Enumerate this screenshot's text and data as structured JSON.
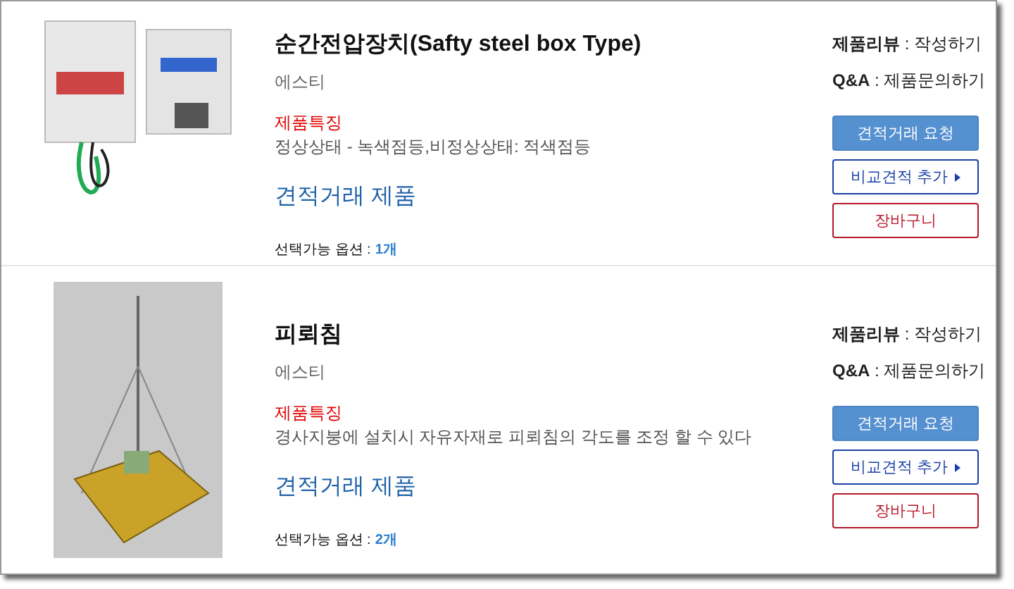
{
  "products": [
    {
      "title": "순간전압장치(Safty steel box Type)",
      "maker": "에스티",
      "feature_label": "제품특징",
      "feature": "정상상태 - 녹색점등,비정상상태: 적색점등",
      "deal_type": "견적거래 제품",
      "options_label": "선택가능 옵션 :",
      "options_count": "1개",
      "review": "**제품리뷰** : 작성하기",
      "qna": "**Q&A** : 제품문의하기",
      "buttons": [
        {
          "kind": "primary",
          "label": "견적거래 요청"
        },
        {
          "kind": "compare",
          "label": "비교견적 추가"
        },
        {
          "kind": "cart",
          "label": "장바구니"
        }
      ]
    },
    {
      "title": "피뢰침",
      "maker": "에스티",
      "feature_label": "제품특징",
      "feature": "경사지붕에 설치시 자유자재로 피뢰침의 각도를 조정 할 수 있다",
      "deal_type": "견적거래 제품",
      "options_label": "선택가능 옵션 :",
      "options_count": "2개",
      "review": "**제품리뷰** : 작성하기",
      "qna": "**Q&A** : 제품문의하기",
      "buttons": [
        {
          "kind": "primary",
          "label": "견적거래 요청"
        },
        {
          "kind": "compare",
          "label": "비교견적 추가"
        },
        {
          "kind": "cart",
          "label": "장바구니"
        }
      ]
    }
  ]
}
